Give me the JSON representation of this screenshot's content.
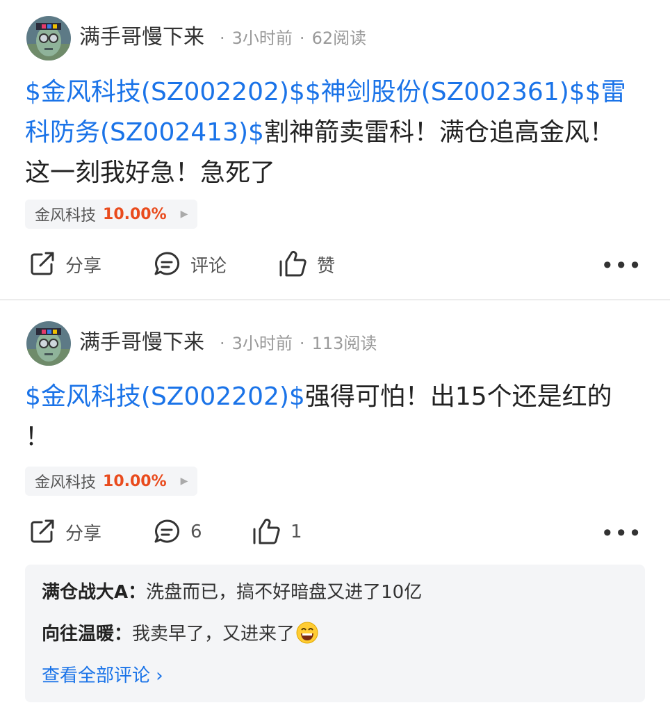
{
  "posts": [
    {
      "author": "满手哥慢下来",
      "time": "3小时前",
      "reads": "62阅读",
      "content_lines": [
        {
          "segments": [
            {
              "text": "$金风科技(SZ002202)$$神剑股份(SZ002361)$$雷",
              "type": "stock"
            }
          ]
        },
        {
          "segments": [
            {
              "text": "科防务(SZ002413)$",
              "type": "stock"
            },
            {
              "text": "割神箭卖雷科！满仓追高金风！",
              "type": "text"
            }
          ]
        },
        {
          "segments": [
            {
              "text": "这一刻我好急！急死了",
              "type": "text"
            }
          ]
        }
      ],
      "chip": {
        "name": "金风科技",
        "change": "10.00%",
        "arrow": "▶"
      },
      "actions": {
        "share": "分享",
        "comment": "评论",
        "like": "赞",
        "more": "•••"
      }
    },
    {
      "author": "满手哥慢下来",
      "time": "3小时前",
      "reads": "113阅读",
      "content_lines": [
        {
          "segments": [
            {
              "text": "$金风科技(SZ002202)$",
              "type": "stock"
            },
            {
              "text": "强得可怕！出15个还是红的",
              "type": "text"
            }
          ]
        },
        {
          "segments": [
            {
              "text": "！",
              "type": "text"
            }
          ]
        }
      ],
      "chip": {
        "name": "金风科技",
        "change": "10.00%",
        "arrow": "▶"
      },
      "actions": {
        "share": "分享",
        "comment": "6",
        "like": "1",
        "more": "•••"
      },
      "comments": [
        {
          "user": "满仓战大A",
          "sep": "：",
          "text": "洗盘而已，搞不好暗盘又进了10亿",
          "emoji": ""
        },
        {
          "user": "向往温暖",
          "sep": "：",
          "text": "我卖早了，又进来了",
          "emoji": "grinning-emoji"
        }
      ],
      "view_all": "查看全部评论 ›"
    }
  ],
  "colors": {
    "stock_link": "#1a73e8",
    "positive_change": "#e94b1d",
    "meta": "#999999",
    "chip_bg": "#f4f5f7"
  }
}
